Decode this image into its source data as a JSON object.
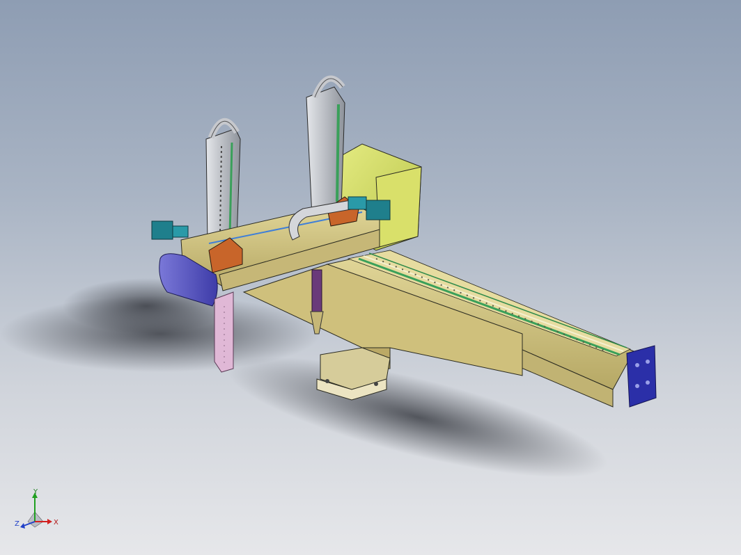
{
  "viewport": {
    "background_top": "#8e9db3",
    "background_bottom": "#e6e7ea"
  },
  "model": {
    "colors": {
      "beam_khaki": "#d8cc8a",
      "beam_khaki_dark": "#b6a865",
      "motor_box_green": "#d6e06a",
      "end_plate_blue": "#2b2fa8",
      "end_cap_purple": "#6c6ad0",
      "carriage_orange": "#c8652a",
      "servo_teal": "#1f7f8c",
      "rail_green": "#3aa05a",
      "base_cream": "#e8e0bc",
      "probe_purple": "#6a3a7a",
      "column_grey": "#b9bcc2",
      "arm_pink": "#e0b8d6"
    }
  },
  "triad": {
    "y_label": "Y",
    "z_label": "Z",
    "x_label": "X",
    "x_color": "#d22020",
    "y_color": "#20a020",
    "z_color": "#2040c8"
  }
}
